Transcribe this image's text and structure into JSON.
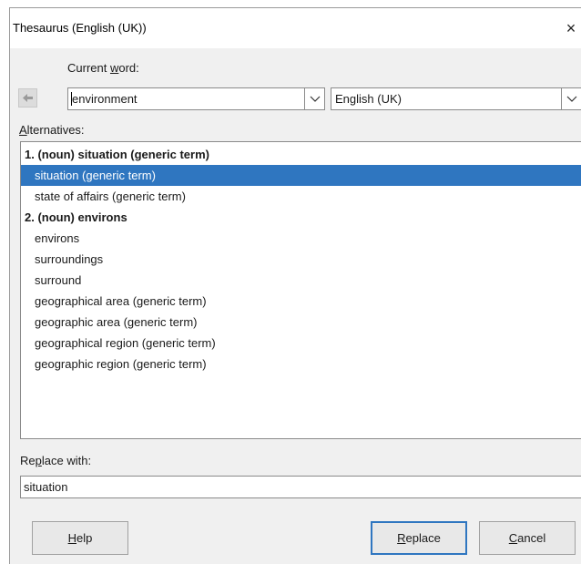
{
  "dialog": {
    "title": "Thesaurus (English (UK))",
    "close_glyph": "×"
  },
  "current_word": {
    "label_before": "Current ",
    "label_mnemonic": "w",
    "label_after": "ord:",
    "value": "environment"
  },
  "language": {
    "value": "English (UK)"
  },
  "alternatives": {
    "label_mnemonic": "A",
    "label_after": "lternatives:",
    "items": [
      {
        "text": "1. (noun) situation (generic term)",
        "kind": "heading",
        "selected": false
      },
      {
        "text": "situation (generic term)",
        "kind": "sub",
        "selected": true
      },
      {
        "text": "state of affairs (generic term)",
        "kind": "sub",
        "selected": false
      },
      {
        "text": "2. (noun) environs",
        "kind": "heading",
        "selected": false
      },
      {
        "text": "environs",
        "kind": "sub",
        "selected": false
      },
      {
        "text": "surroundings",
        "kind": "sub",
        "selected": false
      },
      {
        "text": "surround",
        "kind": "sub",
        "selected": false
      },
      {
        "text": "geographical area (generic term)",
        "kind": "sub",
        "selected": false
      },
      {
        "text": "geographic area (generic term)",
        "kind": "sub",
        "selected": false
      },
      {
        "text": "geographical region (generic term)",
        "kind": "sub",
        "selected": false
      },
      {
        "text": "geographic region (generic term)",
        "kind": "sub",
        "selected": false
      }
    ]
  },
  "replace_with": {
    "label_before": "Re",
    "label_mnemonic": "p",
    "label_after": "lace with:",
    "value": "situation"
  },
  "buttons": {
    "help": {
      "mnemonic": "H",
      "rest": "elp"
    },
    "replace": {
      "mnemonic": "R",
      "rest": "eplace"
    },
    "cancel": {
      "mnemonic": "C",
      "rest": "ancel"
    }
  },
  "icons": {
    "back": "back-arrow-icon",
    "dropdown": "chevron-down-icon",
    "close": "close-icon"
  },
  "colors": {
    "selection": "#2f76c0",
    "dialog_bg": "#f0f0f0"
  }
}
